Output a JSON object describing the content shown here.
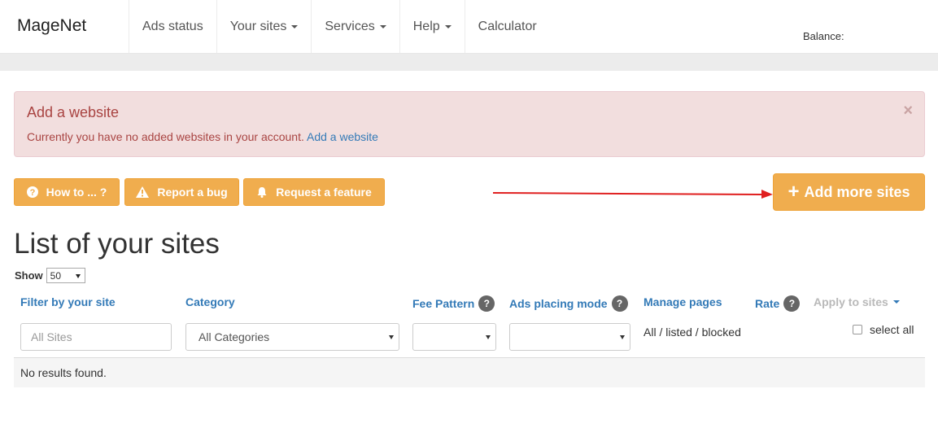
{
  "navbar": {
    "brand": "MageNet",
    "items": [
      {
        "label": "Ads status",
        "dropdown": false
      },
      {
        "label": "Your sites",
        "dropdown": true
      },
      {
        "label": "Services",
        "dropdown": true
      },
      {
        "label": "Help",
        "dropdown": true
      },
      {
        "label": "Calculator",
        "dropdown": false
      }
    ],
    "balance_label": "Balance:"
  },
  "alert": {
    "title": "Add a website",
    "text": "Currently you have no added websites in your account.",
    "link": "Add a website",
    "close": "×"
  },
  "actions": {
    "how_to": "How to ... ?",
    "report_bug": "Report a bug",
    "request_feature": "Request a feature",
    "add_more_sites": "Add more sites"
  },
  "page": {
    "title": "List of your sites",
    "show_label": "Show",
    "show_value": "50"
  },
  "filters": {
    "site": "Filter by your site",
    "category": "Category",
    "fee_pattern": "Fee Pattern",
    "ads_mode": "Ads placing mode",
    "manage_pages": "Manage pages",
    "rate": "Rate",
    "apply_to_sites": "Apply to sites",
    "help_mark": "?"
  },
  "inputs": {
    "site_placeholder": "All Sites",
    "category_value": "All Categories",
    "fee_value": "",
    "mode_value": ""
  },
  "manage": {
    "all": "All",
    "listed": "listed",
    "blocked": "blocked",
    "sep": " / "
  },
  "select_all": "select all",
  "results": {
    "empty": "No results found."
  },
  "colors": {
    "warning": "#f0ad4e",
    "link": "#337ab7",
    "danger_bg": "#f2dede",
    "danger_text": "#a94442",
    "arrow": "#e02020"
  }
}
